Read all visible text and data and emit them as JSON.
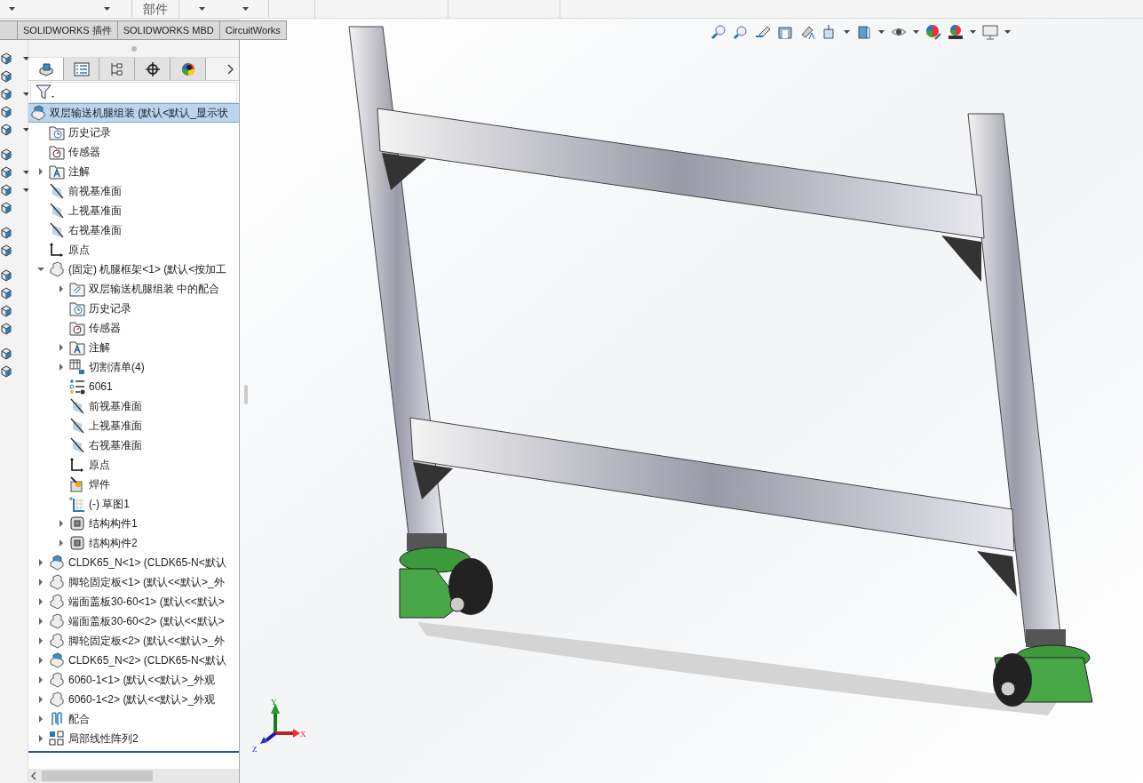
{
  "top_bar": {
    "label": "部件"
  },
  "command_tabs": [
    {
      "label": "SOLIDWORKS 插件",
      "selected": false
    },
    {
      "label": "SOLIDWORKS MBD",
      "selected": false
    },
    {
      "label": "CircuitWorks",
      "selected": false
    }
  ],
  "panel_tabs": [
    {
      "selected": true
    },
    {
      "selected": false
    },
    {
      "selected": false
    },
    {
      "selected": false
    },
    {
      "selected": false
    }
  ],
  "tree": [
    {
      "label": "双层输送机腿组装  (默认<默认_显示状",
      "kind": "assembly",
      "selected": true,
      "children": [
        {
          "label": "历史记录",
          "kind": "history",
          "selected": false
        },
        {
          "label": "传感器",
          "kind": "sensor",
          "selected": false
        },
        {
          "label": "注解",
          "kind": "annotation",
          "expanded": false,
          "selected": false
        },
        {
          "label": "前视基准面",
          "kind": "plane",
          "selected": false
        },
        {
          "label": "上视基准面",
          "kind": "plane",
          "selected": false
        },
        {
          "label": "右视基准面",
          "kind": "plane",
          "selected": false
        },
        {
          "label": "原点",
          "kind": "origin",
          "selected": false
        },
        {
          "label": "(固定) 机腿框架<1> (默认<按加工",
          "kind": "part",
          "expanded": true,
          "selected": false,
          "children": [
            {
              "label": "双层输送机腿组装 中的配合",
              "kind": "mates-folder",
              "expanded": false,
              "selected": false
            },
            {
              "label": "历史记录",
              "kind": "history",
              "selected": false
            },
            {
              "label": "传感器",
              "kind": "sensor",
              "selected": false
            },
            {
              "label": "注解",
              "kind": "annotation",
              "expanded": false,
              "selected": false
            },
            {
              "label": "切割清单(4)",
              "kind": "cutlist",
              "expanded": false,
              "selected": false
            },
            {
              "label": "6061",
              "kind": "material",
              "selected": false
            },
            {
              "label": "前视基准面",
              "kind": "plane",
              "selected": false
            },
            {
              "label": "上视基准面",
              "kind": "plane",
              "selected": false
            },
            {
              "label": "右视基准面",
              "kind": "plane",
              "selected": false
            },
            {
              "label": "原点",
              "kind": "origin",
              "selected": false
            },
            {
              "label": "焊件",
              "kind": "weldment",
              "selected": false
            },
            {
              "label": "(-) 草图1",
              "kind": "sketch",
              "selected": false
            },
            {
              "label": "结构构件1",
              "kind": "member",
              "expanded": false,
              "selected": false
            },
            {
              "label": "结构构件2",
              "kind": "member",
              "expanded": false,
              "selected": false
            }
          ]
        },
        {
          "label": "CLDK65_N<1> (CLDK65-N<默认",
          "kind": "assembly",
          "expanded": false,
          "selected": false
        },
        {
          "label": "脚轮固定板<1> (默认<<默认>_外",
          "kind": "part",
          "expanded": false,
          "selected": false
        },
        {
          "label": "端面盖板30-60<1> (默认<<默认>",
          "kind": "part",
          "expanded": false,
          "selected": false
        },
        {
          "label": "端面盖板30-60<2> (默认<<默认>",
          "kind": "part",
          "expanded": false,
          "selected": false
        },
        {
          "label": "脚轮固定板<2> (默认<<默认>_外",
          "kind": "part",
          "expanded": false,
          "selected": false
        },
        {
          "label": "CLDK65_N<2> (CLDK65-N<默认",
          "kind": "assembly",
          "expanded": false,
          "selected": false
        },
        {
          "label": "6060-1<1> (默认<<默认>_外观",
          "kind": "part",
          "expanded": false,
          "selected": false
        },
        {
          "label": "6060-1<2> (默认<<默认>_外观",
          "kind": "part",
          "expanded": false,
          "selected": false
        },
        {
          "label": "配合",
          "kind": "mates",
          "expanded": false,
          "selected": false
        },
        {
          "label": "局部线性阵列2",
          "kind": "pattern",
          "expanded": false,
          "selected": false
        }
      ]
    }
  ],
  "triad": {
    "x": "X",
    "y": "Y",
    "z": "Z"
  }
}
